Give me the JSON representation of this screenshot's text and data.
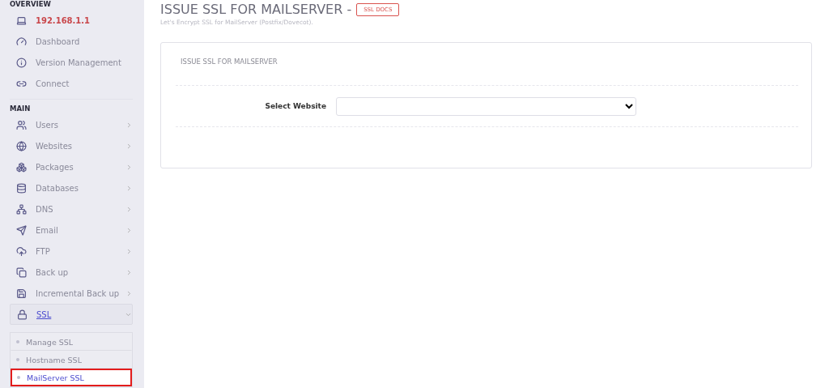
{
  "sidebar": {
    "sections": [
      {
        "heading": "OVERVIEW",
        "items": [
          {
            "label": "192.168.1.1",
            "kind": "host",
            "has_arrow": false
          },
          {
            "label": "Dashboard",
            "kind": "link",
            "has_arrow": false
          },
          {
            "label": "Version Management",
            "kind": "link",
            "has_arrow": false
          },
          {
            "label": "Connect",
            "kind": "link",
            "has_arrow": false
          }
        ]
      },
      {
        "heading": "MAIN",
        "items": [
          {
            "label": "Users",
            "kind": "link",
            "has_arrow": true
          },
          {
            "label": "Websites",
            "kind": "link",
            "has_arrow": true
          },
          {
            "label": "Packages",
            "kind": "link",
            "has_arrow": true
          },
          {
            "label": "Databases",
            "kind": "link",
            "has_arrow": true
          },
          {
            "label": "DNS",
            "kind": "link",
            "has_arrow": true
          },
          {
            "label": "Email",
            "kind": "link",
            "has_arrow": true
          },
          {
            "label": "FTP",
            "kind": "link",
            "has_arrow": true
          },
          {
            "label": "Back up",
            "kind": "link",
            "has_arrow": true
          },
          {
            "label": "Incremental Back up",
            "kind": "link",
            "has_arrow": true
          },
          {
            "label": "SSL",
            "kind": "link",
            "has_arrow": true,
            "expanded": true,
            "children": [
              {
                "label": "Manage SSL",
                "selected": false,
                "highlighted": false
              },
              {
                "label": "Hostname SSL",
                "selected": false,
                "highlighted": false
              },
              {
                "label": "MailServer SSL",
                "selected": true,
                "highlighted": true
              }
            ]
          }
        ]
      }
    ]
  },
  "header": {
    "title": "ISSUE SSL FOR MAILSERVER -",
    "badge": "SSL DOCS",
    "subtitle": "Let's Encrypt SSL for MailServer (Postfix/Dovecot)."
  },
  "card": {
    "title": "ISSUE SSL FOR MAILSERVER",
    "field": {
      "label": "Select Website"
    }
  }
}
